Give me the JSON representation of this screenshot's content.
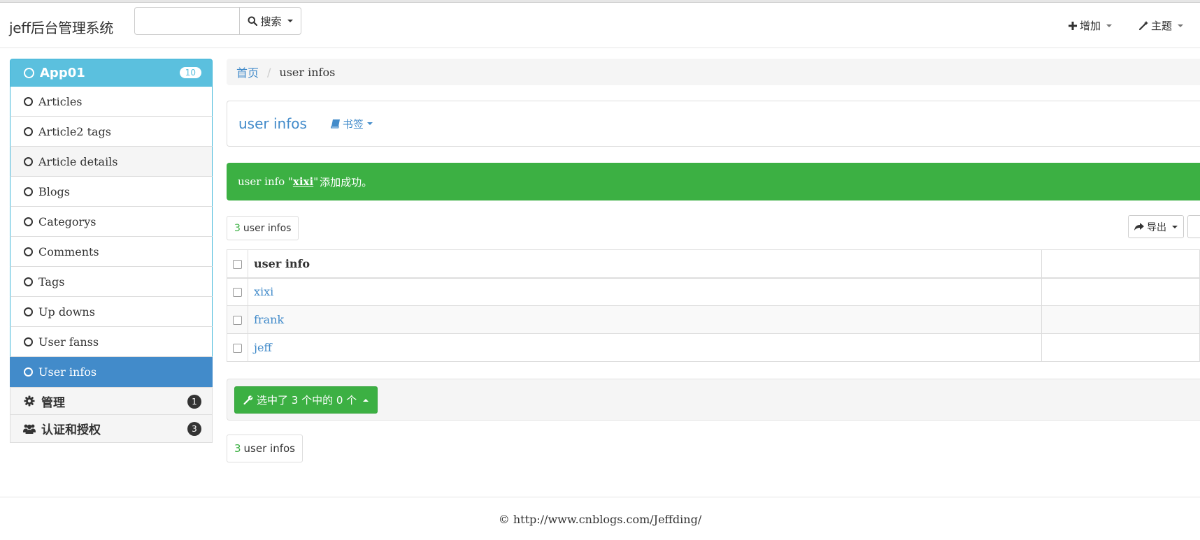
{
  "navbar": {
    "brand": "jeff后台管理系统",
    "search_value": "",
    "search_label": "搜索",
    "add_label": "增加",
    "theme_label": "主题"
  },
  "sidebar": {
    "app": {
      "label": "App01",
      "count": "10"
    },
    "items": [
      {
        "label": "Articles"
      },
      {
        "label": "Article2 tags"
      },
      {
        "label": "Article details"
      },
      {
        "label": "Blogs"
      },
      {
        "label": "Categorys"
      },
      {
        "label": "Comments"
      },
      {
        "label": "Tags"
      },
      {
        "label": "Up downs"
      },
      {
        "label": "User fanss"
      },
      {
        "label": "User infos"
      }
    ],
    "active_item": "User infos",
    "sections": [
      {
        "label": "管理",
        "count": "1",
        "icon": "gear-icon"
      },
      {
        "label": "认证和授权",
        "count": "3",
        "icon": "users-icon"
      }
    ]
  },
  "breadcrumb": {
    "home": "首页",
    "current": "user infos"
  },
  "page_header": {
    "title": "user infos",
    "bookmark_label": "书签"
  },
  "alert": {
    "prefix": "user info \"",
    "object": "xixi",
    "suffix": "\"",
    "message": "添加成功。"
  },
  "counts": {
    "number": "3",
    "label": "user infos"
  },
  "export_label": "导出",
  "table": {
    "column": "user info",
    "rows": [
      {
        "name": "xixi"
      },
      {
        "name": "frank"
      },
      {
        "name": "jeff"
      }
    ]
  },
  "action": {
    "label": "选中了 3 个中的 0 个"
  },
  "footer": {
    "text": "© http://www.cnblogs.com/Jeffding/"
  },
  "colors": {
    "info": "#5bc0de",
    "primary": "#428bca",
    "success": "#3cb043"
  }
}
